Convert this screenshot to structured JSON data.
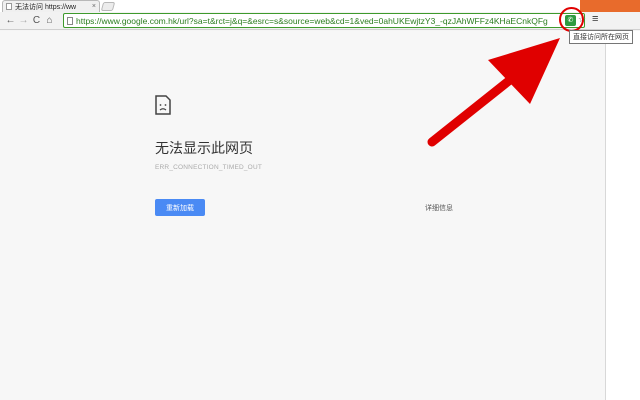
{
  "tab": {
    "title": "无法访问 https://ww",
    "close": "×"
  },
  "toolbar": {
    "back": "←",
    "forward": "→",
    "reload": "C",
    "home": "⌂",
    "url": "https://www.google.com.hk/url?sa=t&rct=j&q=&esrc=s&source=web&cd=1&ved=0ahUKEwjtzY3_-qzJAhWFFz4KHaECnkQFg",
    "ext_glyph": "✆",
    "star": "☆",
    "menu": "≡"
  },
  "tooltip": {
    "text": "直接访问所在网页"
  },
  "error": {
    "title": "无法显示此网页",
    "code": "ERR_CONNECTION_TIMED_OUT",
    "reload_label": "重新加载",
    "details_label": "详细信息"
  },
  "colors": {
    "accent_blue": "#4a8af4",
    "omnibox_green": "#3e9a2c",
    "annotation_red": "#e00000"
  }
}
